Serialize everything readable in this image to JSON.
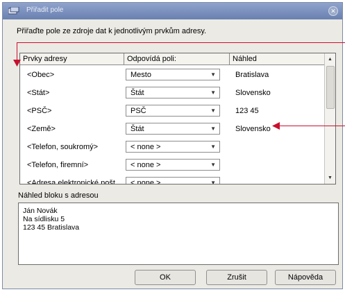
{
  "window": {
    "title": "Přiřadit pole"
  },
  "instruction": "Přiřaďte pole ze zdroje dat k jednotlivým prvkům adresy.",
  "table": {
    "headers": {
      "elements": "Prvky adresy",
      "matches": "Odpovídá poli:",
      "preview": "Náhled"
    },
    "rows": [
      {
        "field": "<Obec>",
        "match": "Mesto",
        "preview": "Bratislava"
      },
      {
        "field": "<Stát>",
        "match": "Štát",
        "preview": "Slovensko"
      },
      {
        "field": "<PSČ>",
        "match": "PSČ",
        "preview": "123 45"
      },
      {
        "field": "<Země>",
        "match": "Štát",
        "preview": "Slovensko"
      },
      {
        "field": "<Telefon, soukromý>",
        "match": "< none >",
        "preview": ""
      },
      {
        "field": "<Telefon, firemní>",
        "match": "< none >",
        "preview": ""
      },
      {
        "field": "<Adresa elektronické pošt",
        "match": "< none >",
        "preview": ""
      }
    ]
  },
  "block": {
    "label": "Náhled bloku s adresou",
    "lines": [
      "Ján Novák",
      "Na sídlisku 5",
      "123 45 Bratislava"
    ]
  },
  "buttons": {
    "ok": "OK",
    "cancel": "Zrušit",
    "help": "Nápověda"
  },
  "colors": {
    "annotation": "#c8102e",
    "titlebar": "#7589bb"
  },
  "icons": {
    "app": "app-icon",
    "close": "close-icon",
    "combo_arrow": "dropdown-arrow-icon"
  }
}
